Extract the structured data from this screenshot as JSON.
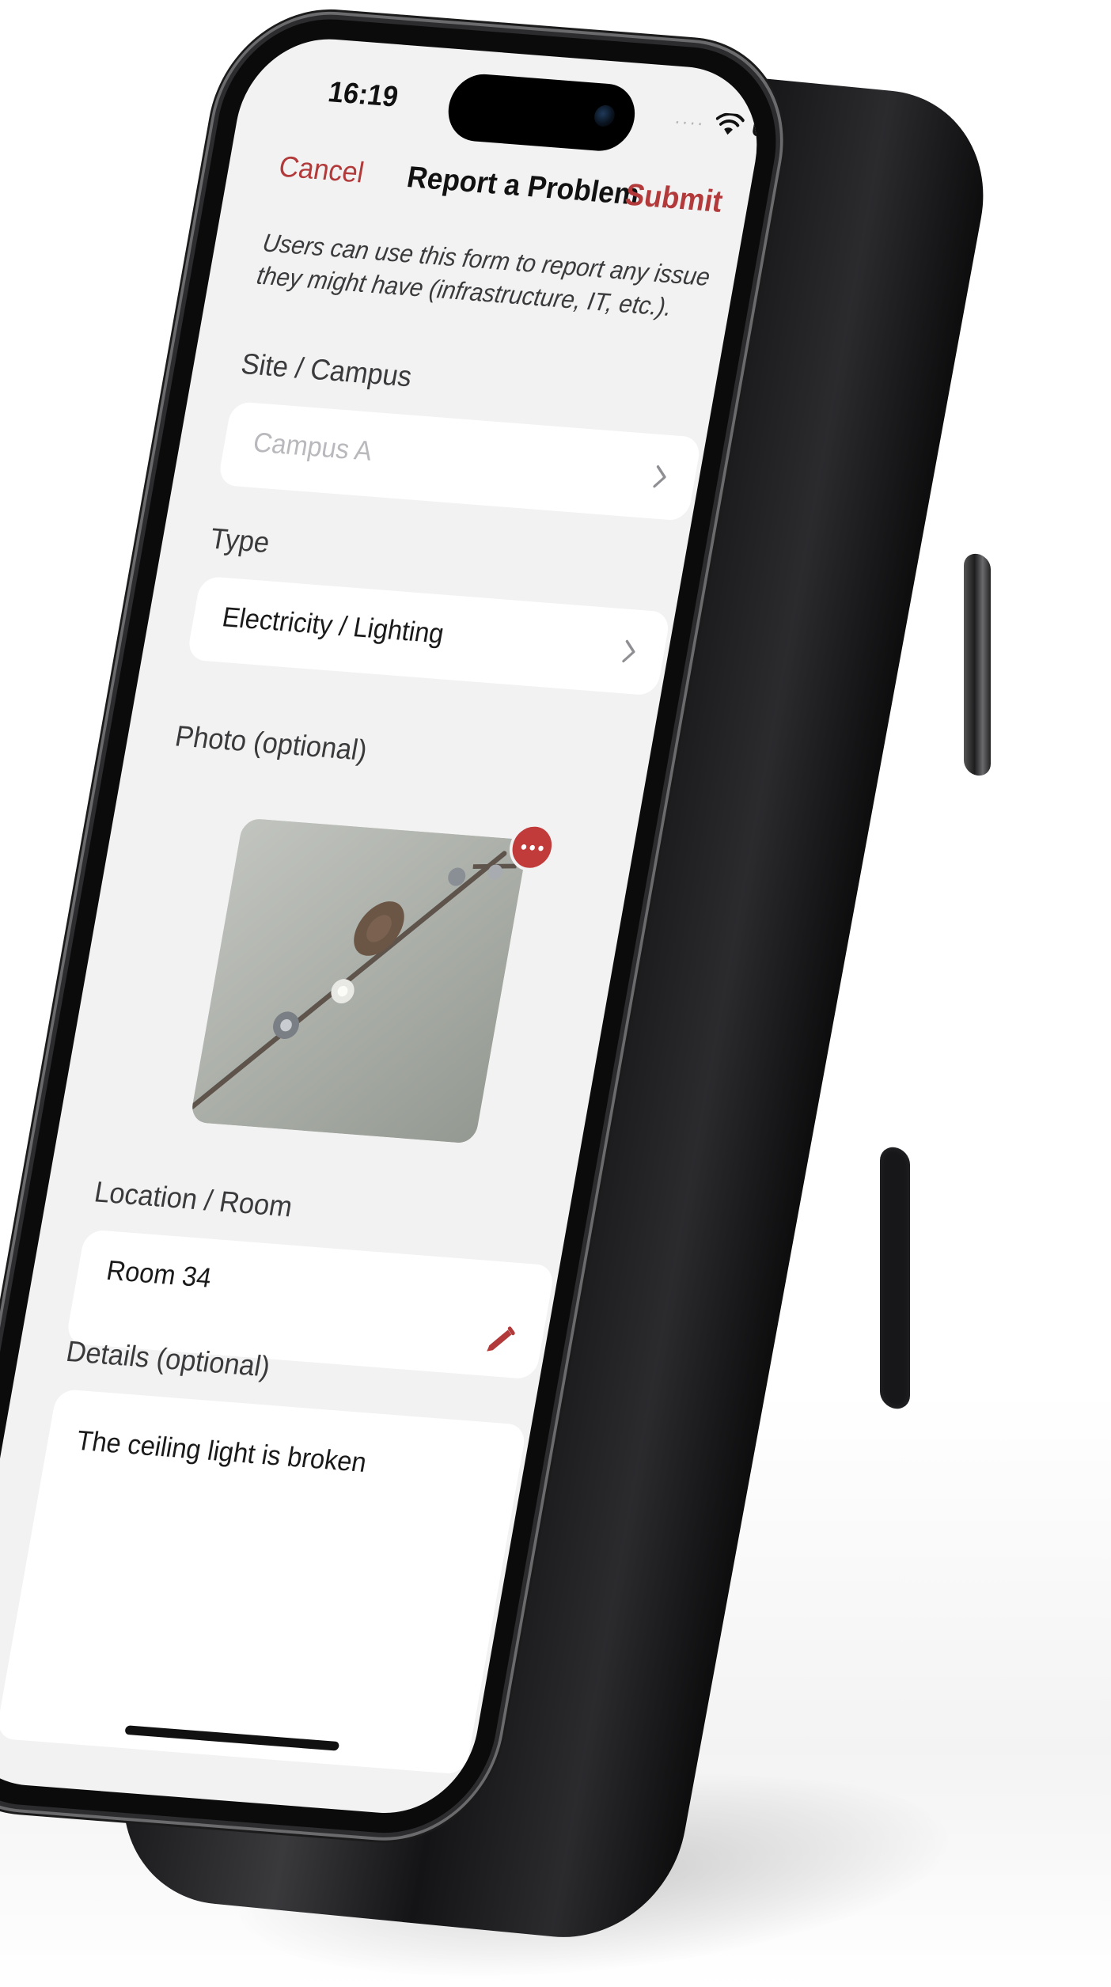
{
  "status_bar": {
    "time": "16:19",
    "signal_icon": "cellular-signal-icon",
    "wifi_icon": "wifi-icon",
    "battery_icon": "battery-icon"
  },
  "navigation": {
    "cancel_label": "Cancel",
    "title": "Report a Problem",
    "submit_label": "Submit"
  },
  "intro_text": "Users can use this form to report any issue they might have (infrastructure, IT, etc.).",
  "form": {
    "site": {
      "label": "Site / Campus",
      "placeholder": "Campus A",
      "icon": "chevron-right-icon"
    },
    "type": {
      "label": "Type",
      "value": "Electricity / Lighting",
      "icon": "chevron-right-icon"
    },
    "photo": {
      "label": "Photo (optional)",
      "more_icon": "ellipsis-icon"
    },
    "location": {
      "label": "Location / Room",
      "value": "Room 34",
      "icon": "pencil-icon"
    },
    "details": {
      "label": "Details (optional)",
      "value": "The ceiling light is broken"
    }
  },
  "colors": {
    "accent": "#b33a3a",
    "background": "#f2f2f2",
    "field": "#ffffff",
    "text": "#1a1a1a",
    "placeholder": "#b9b9bd"
  }
}
